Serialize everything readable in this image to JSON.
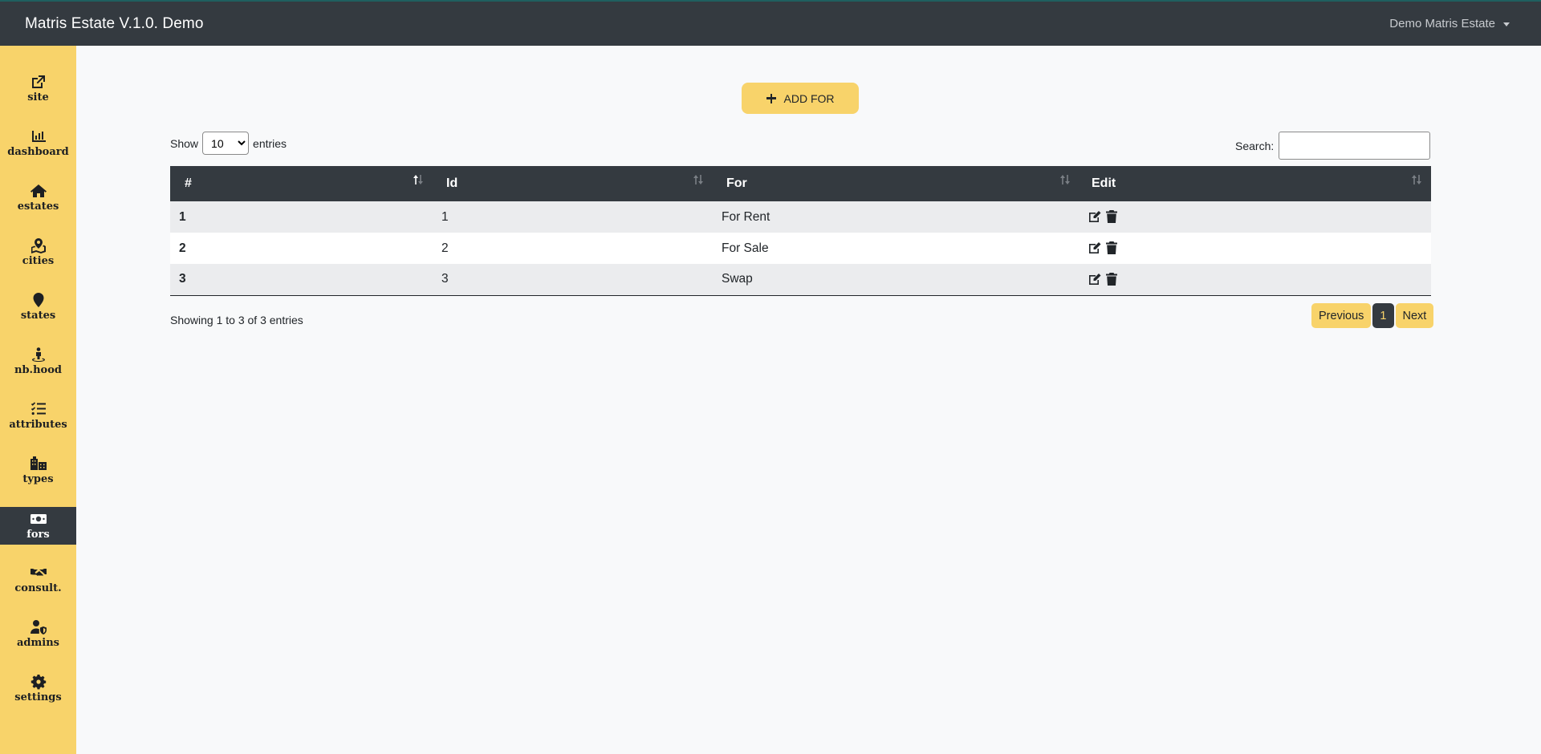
{
  "header": {
    "brand": "Matris Estate V.1.0. Demo",
    "user_menu": "Demo Matris Estate"
  },
  "sidebar": {
    "items": [
      {
        "label": "site",
        "icon": "external-link-icon",
        "active": false
      },
      {
        "label": "dashboard",
        "icon": "bar-chart-icon",
        "active": false
      },
      {
        "label": "estates",
        "icon": "home-icon",
        "active": false
      },
      {
        "label": "cities",
        "icon": "map-marked-icon",
        "active": false
      },
      {
        "label": "states",
        "icon": "map-marker-icon",
        "active": false
      },
      {
        "label": "nb.hood",
        "icon": "street-view-icon",
        "active": false
      },
      {
        "label": "attributes",
        "icon": "tasks-list-icon",
        "active": false
      },
      {
        "label": "types",
        "icon": "city-buildings-icon",
        "active": false
      },
      {
        "label": "fors",
        "icon": "money-bill-icon",
        "active": true
      },
      {
        "label": "consult.",
        "icon": "handshake-icon",
        "active": false
      },
      {
        "label": "admins",
        "icon": "user-shield-icon",
        "active": false
      },
      {
        "label": "settings",
        "icon": "gear-icon",
        "active": false
      }
    ]
  },
  "main": {
    "add_button": "ADD FOR",
    "length": {
      "prefix": "Show",
      "selected": "10",
      "suffix": "entries"
    },
    "search": {
      "label": "Search:",
      "value": ""
    },
    "table": {
      "columns": [
        "#",
        "Id",
        "For",
        "Edit"
      ],
      "rows": [
        {
          "num": "1",
          "id": "1",
          "for": "For Rent"
        },
        {
          "num": "2",
          "id": "2",
          "for": "For Sale"
        },
        {
          "num": "3",
          "id": "3",
          "for": "Swap"
        }
      ]
    },
    "info": "Showing 1 to 3 of 3 entries",
    "pagination": {
      "previous": "Previous",
      "current": "1",
      "next": "Next"
    }
  },
  "colors": {
    "accent": "#f8d36a",
    "dark": "#343a40",
    "background": "#f8f9fa"
  }
}
